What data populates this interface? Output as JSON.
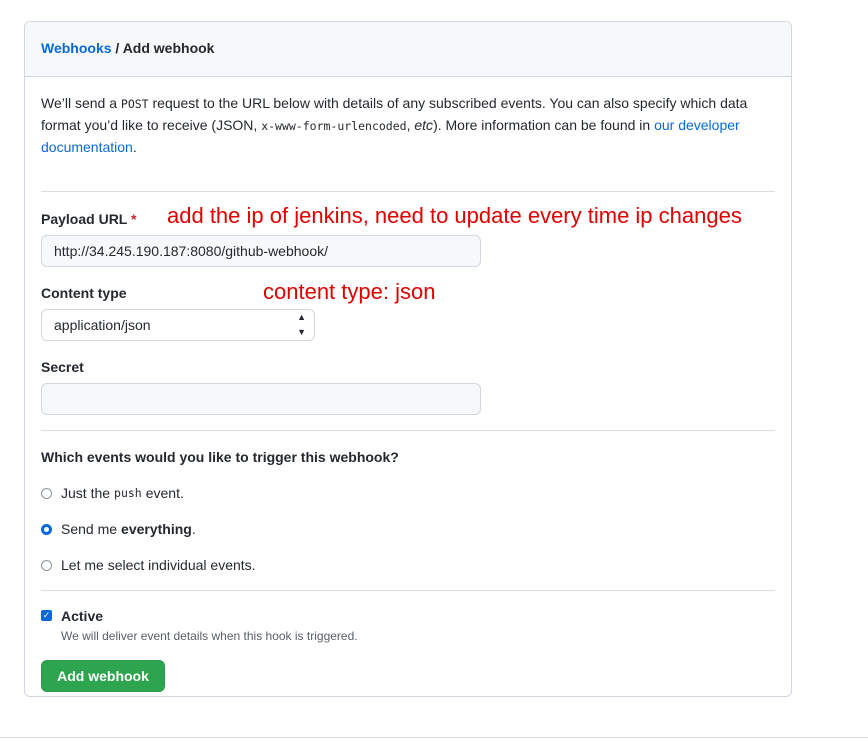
{
  "header": {
    "breadcrumb_link": "Webhooks",
    "separator": "/",
    "title": "Add webhook"
  },
  "intro": {
    "part1": "We’ll send a ",
    "code1": "POST",
    "part2": " request to the URL below with details of any subscribed events. You can also specify which data format you’d like to receive (JSON, ",
    "code2": "x-www-form-urlencoded",
    "part3": ", ",
    "etc": "etc",
    "part4": "). More information can be found in ",
    "link": "our developer documentation",
    "part5": "."
  },
  "form": {
    "payload_label": "Payload URL",
    "required_mark": "*",
    "payload_value": "http://34.245.190.187:8080/github-webhook/",
    "content_type_label": "Content type",
    "content_type_value": "application/json",
    "secret_label": "Secret",
    "secret_value": ""
  },
  "annotations": {
    "payload_note": "add the ip of jenkins, need to update every time ip changes",
    "content_type_note": "content type: json"
  },
  "events": {
    "question": "Which events would you like to trigger this webhook?",
    "options": [
      {
        "prefix": "Just the ",
        "code": "push",
        "suffix": " event.",
        "selected": false
      },
      {
        "prefix": "Send me ",
        "strong": "everything",
        "suffix": ".",
        "selected": true
      },
      {
        "prefix": "Let me select individual events.",
        "selected": false
      }
    ]
  },
  "active": {
    "label": "Active",
    "checked": true,
    "hint": "We will deliver event details when this hook is triggered."
  },
  "submit_label": "Add webhook",
  "colors": {
    "link": "#0969da",
    "button": "#2da44e",
    "annotation": "#e00000",
    "required": "#cf222e"
  }
}
